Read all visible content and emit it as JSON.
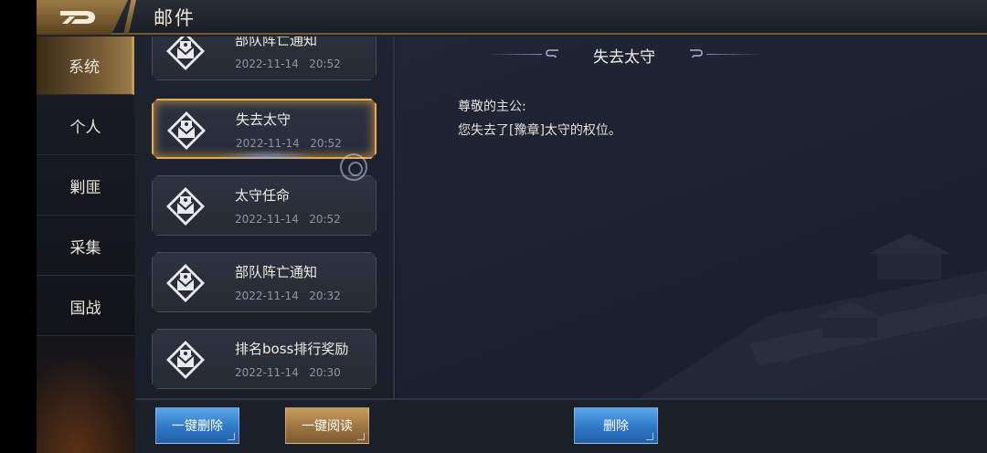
{
  "header": {
    "title": "邮件",
    "back_icon": "back-logo-icon",
    "accent": "#c59a52"
  },
  "tabs": [
    {
      "label": "系统",
      "active": true
    },
    {
      "label": "个人",
      "active": false
    },
    {
      "label": "剿匪",
      "active": false
    },
    {
      "label": "采集",
      "active": false
    },
    {
      "label": "国战",
      "active": false
    }
  ],
  "mail_list": [
    {
      "subject": "部队阵亡通知",
      "date": "2022-11-14",
      "time": "20:52",
      "selected": false
    },
    {
      "subject": "失去太守",
      "date": "2022-11-14",
      "time": "20:52",
      "selected": true
    },
    {
      "subject": "太守任命",
      "date": "2022-11-14",
      "time": "20:52",
      "selected": false
    },
    {
      "subject": "部队阵亡通知",
      "date": "2022-11-14",
      "time": "20:32",
      "selected": false
    },
    {
      "subject": "排名boss排行奖励",
      "date": "2022-11-14",
      "time": "20:30",
      "selected": false
    }
  ],
  "detail": {
    "title": "失去太守",
    "greeting": "尊敬的主公:",
    "body": "您失去了[豫章]太守的权位。"
  },
  "buttons": {
    "delete_all": "一键删除",
    "read_all": "一键阅读",
    "delete": "删除"
  },
  "colors": {
    "selected_border": "#e5a94e",
    "button_blue": "#2f78c8",
    "button_gold": "#9c7440"
  }
}
